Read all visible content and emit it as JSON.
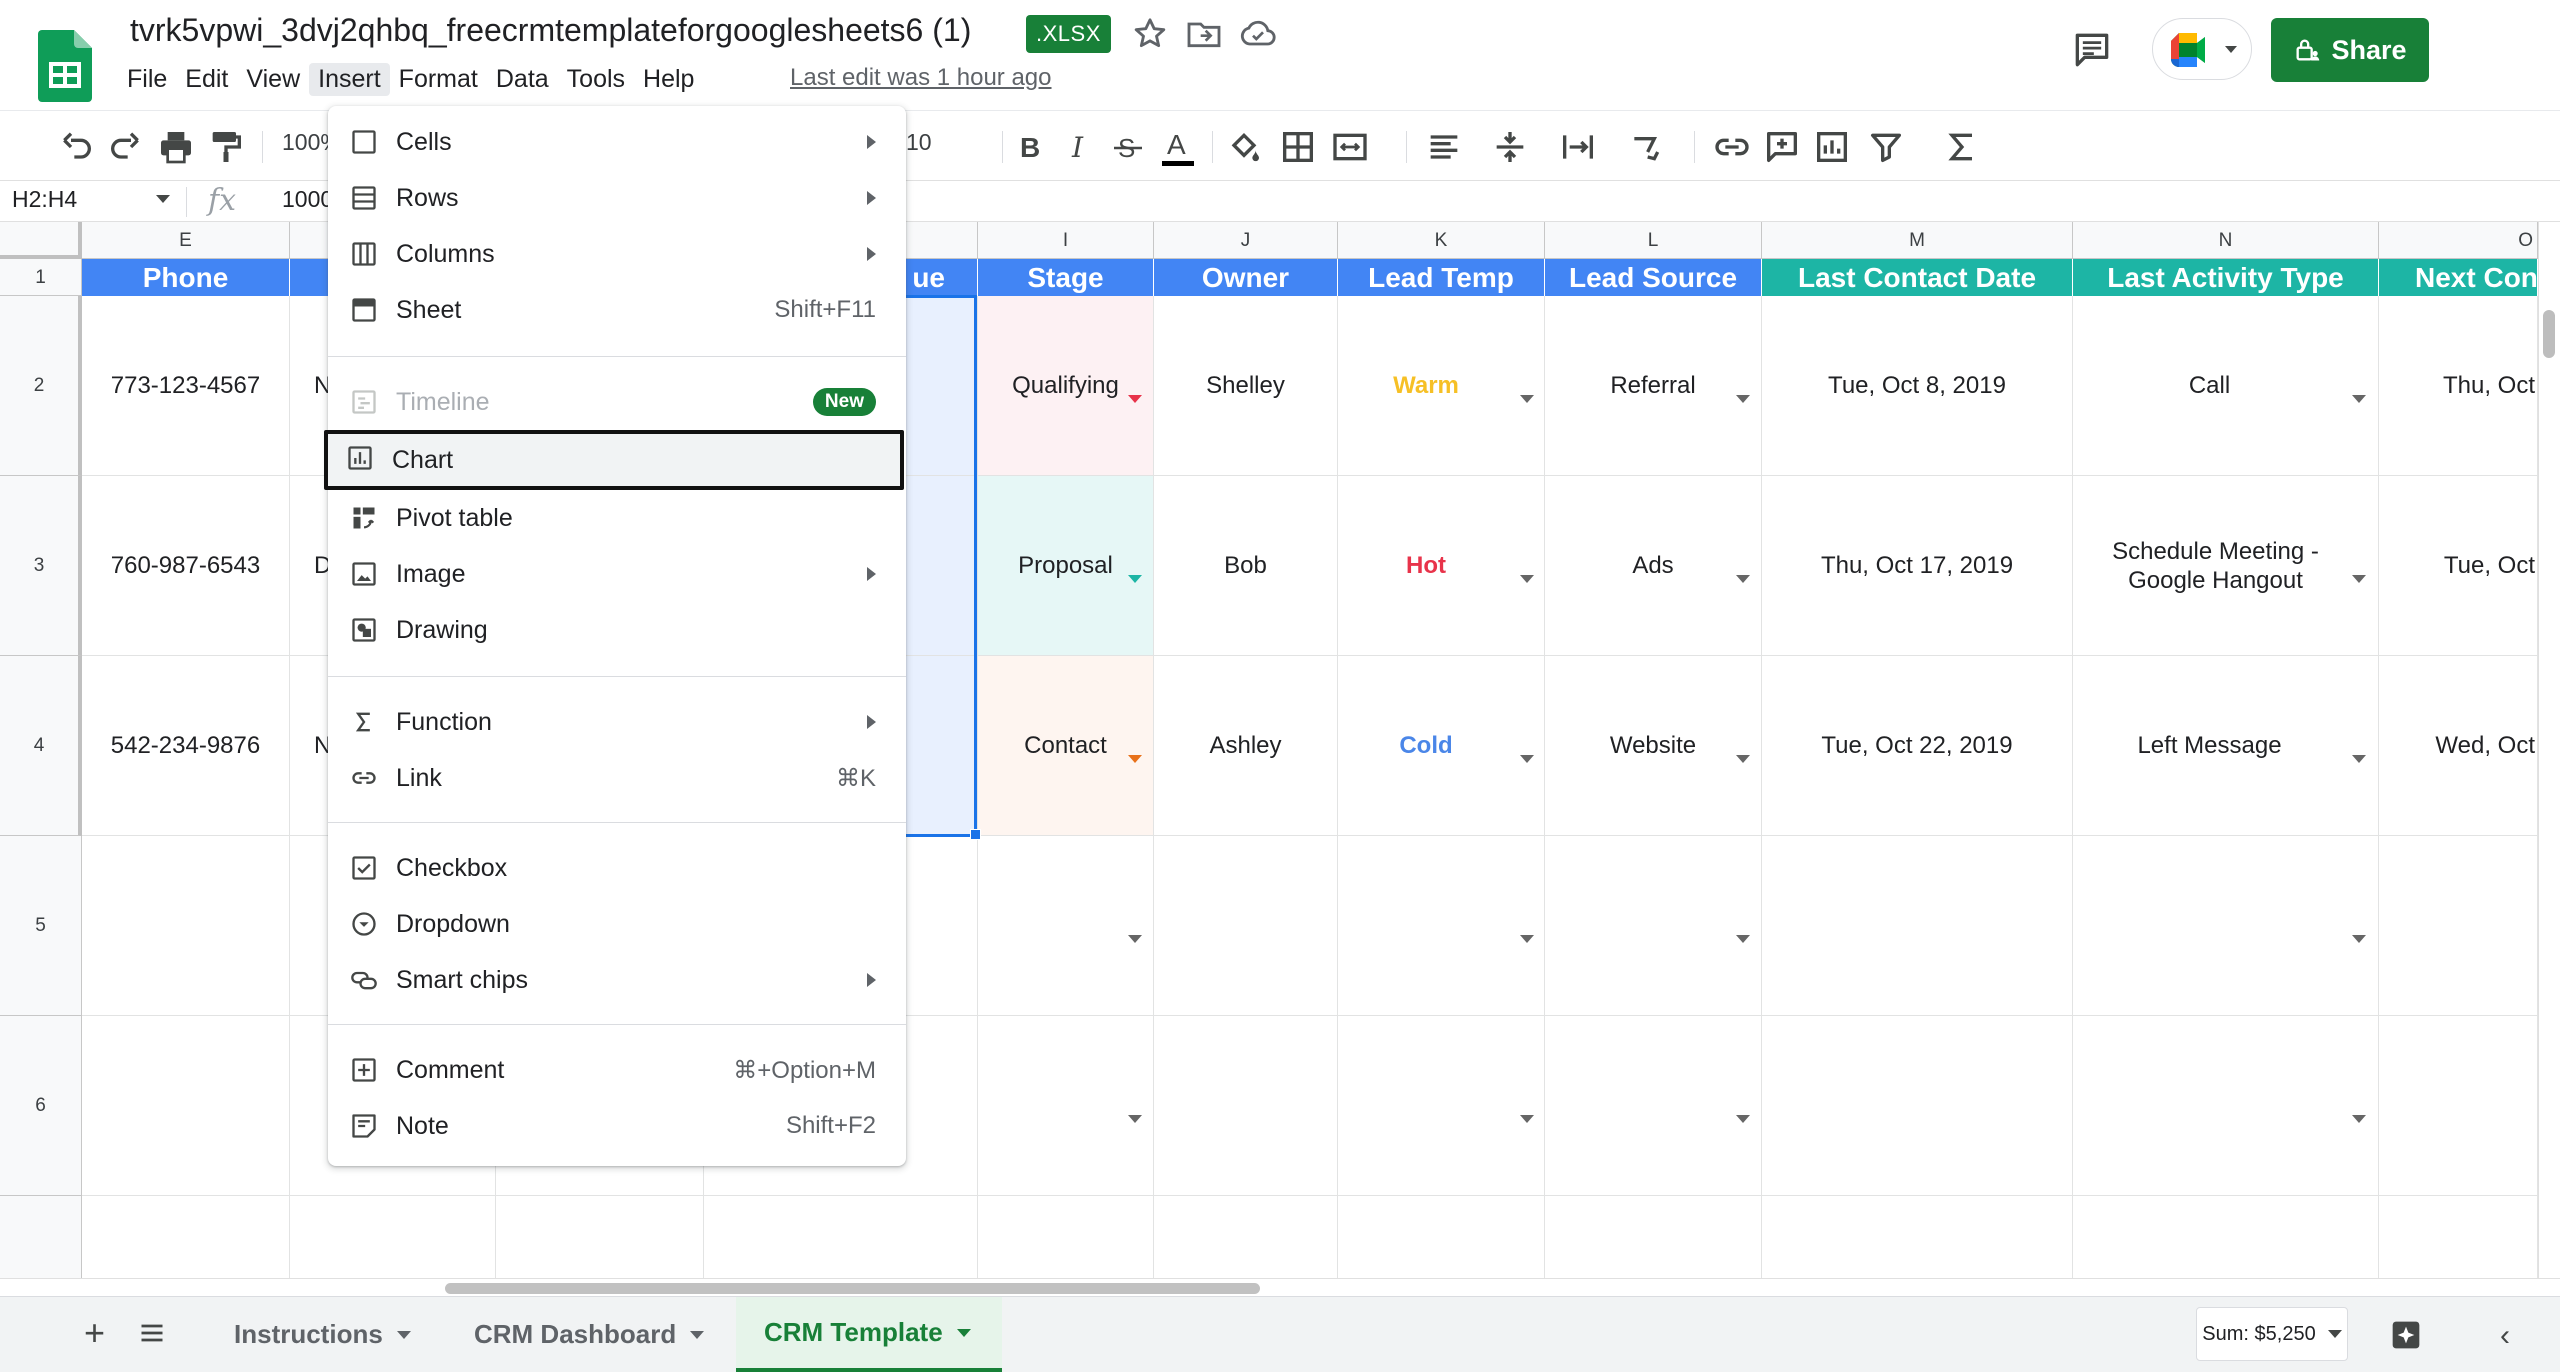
{
  "app": {
    "doc_title": "tvrk5vpwi_3dvj2qhbq_freecrmtemplateforgooglesheets6 (1)",
    "file_badge": ".XLSX",
    "last_edit": "Last edit was 1 hour ago",
    "share_label": "Share",
    "menus": [
      "File",
      "Edit",
      "View",
      "Insert",
      "Format",
      "Data",
      "Tools",
      "Help"
    ],
    "active_menu": "Insert"
  },
  "toolbar": {
    "zoom": "100%",
    "font_size": "10",
    "icons": [
      "undo-icon",
      "redo-icon",
      "print-icon",
      "paint-format-icon",
      "bold-icon",
      "italic-icon",
      "strikethrough-icon",
      "text-color-icon",
      "fill-color-icon",
      "borders-icon",
      "merge-cells-icon",
      "align-icon",
      "valign-icon",
      "wrap-icon",
      "rotate-icon",
      "link-icon",
      "comment-icon",
      "chart-icon",
      "filter-icon",
      "functions-icon"
    ]
  },
  "formula_bar": {
    "name_box": "H2:H4",
    "value": "1000"
  },
  "grid": {
    "columns": [
      {
        "letter": "E",
        "header": "Phone",
        "header_color": "blue"
      },
      {
        "letter": "",
        "header": "",
        "header_color": "blue"
      },
      {
        "letter": "",
        "header": "",
        "header_color": "blue"
      },
      {
        "letter": "",
        "header": "ue",
        "header_color": "blue"
      },
      {
        "letter": "I",
        "header": "Stage",
        "header_color": "blue"
      },
      {
        "letter": "J",
        "header": "Owner",
        "header_color": "blue"
      },
      {
        "letter": "K",
        "header": "Lead Temp",
        "header_color": "blue"
      },
      {
        "letter": "L",
        "header": "Lead Source",
        "header_color": "blue"
      },
      {
        "letter": "M",
        "header": "Last Contact Date",
        "header_color": "teal"
      },
      {
        "letter": "N",
        "header": "Last Activity Type",
        "header_color": "teal"
      },
      {
        "letter": "O",
        "header": "Next Con",
        "header_color": "teal"
      }
    ],
    "row_numbers": [
      "1",
      "2",
      "3",
      "4",
      "5",
      "6"
    ],
    "rows": [
      {
        "phone": "773-123-4567",
        "f_partial": "N",
        "stage": "Qualifying",
        "owner": "Shelley",
        "temp": "Warm",
        "source": "Referral",
        "last_contact": "Tue, Oct 8, 2019",
        "activity": "Call",
        "next": "Thu, Oct"
      },
      {
        "phone": "760-987-6543",
        "f_partial": "D",
        "stage": "Proposal",
        "owner": "Bob",
        "temp": "Hot",
        "source": "Ads",
        "last_contact": "Thu, Oct 17, 2019",
        "activity": "Schedule Meeting - Google Hangout",
        "next": "Tue, Oct"
      },
      {
        "phone": "542-234-9876",
        "f_partial": "N",
        "stage": "Contact",
        "owner": "Ashley",
        "temp": "Cold",
        "source": "Website",
        "last_contact": "Tue, Oct 22, 2019",
        "activity": "Left Message",
        "next": "Wed, Oct"
      }
    ],
    "colors": {
      "header_blue": "#4285f4",
      "header_teal": "#1db5a5",
      "warm": "#f6c026",
      "hot": "#e8334a",
      "cold": "#4a86e8",
      "stage_qualifying_bg": "#fdf1f3",
      "stage_proposal_bg": "#e6f7f6",
      "stage_contact_bg": "#fef5f0",
      "selection_bg": "#e8f0fe",
      "selection_border": "#1a73e8"
    }
  },
  "insert_menu": {
    "items": [
      {
        "label": "Cells",
        "icon": "cells-icon",
        "submenu": true
      },
      {
        "label": "Rows",
        "icon": "rows-icon",
        "submenu": true
      },
      {
        "label": "Columns",
        "icon": "columns-icon",
        "submenu": true
      },
      {
        "label": "Sheet",
        "icon": "sheet-icon",
        "shortcut": "Shift+F11"
      },
      {
        "label": "Timeline",
        "icon": "timeline-icon",
        "badge": "New",
        "disabled": true
      },
      {
        "label": "Chart",
        "icon": "chart-icon",
        "highlighted": true
      },
      {
        "label": "Pivot table",
        "icon": "pivot-table-icon"
      },
      {
        "label": "Image",
        "icon": "image-icon",
        "submenu": true
      },
      {
        "label": "Drawing",
        "icon": "drawing-icon"
      },
      {
        "label": "Function",
        "icon": "sigma-icon",
        "submenu": true
      },
      {
        "label": "Link",
        "icon": "link-icon",
        "shortcut": "⌘K"
      },
      {
        "label": "Checkbox",
        "icon": "checkbox-icon"
      },
      {
        "label": "Dropdown",
        "icon": "dropdown-icon"
      },
      {
        "label": "Smart chips",
        "icon": "smart-chips-icon",
        "submenu": true
      },
      {
        "label": "Comment",
        "icon": "comment-plus-icon",
        "shortcut": "⌘+Option+M"
      },
      {
        "label": "Note",
        "icon": "note-icon",
        "shortcut": "Shift+F2"
      }
    ]
  },
  "sheets": {
    "tabs": [
      "Instructions",
      "CRM Dashboard",
      "CRM Template"
    ],
    "active": "CRM Template",
    "sum": "Sum: $5,250"
  }
}
